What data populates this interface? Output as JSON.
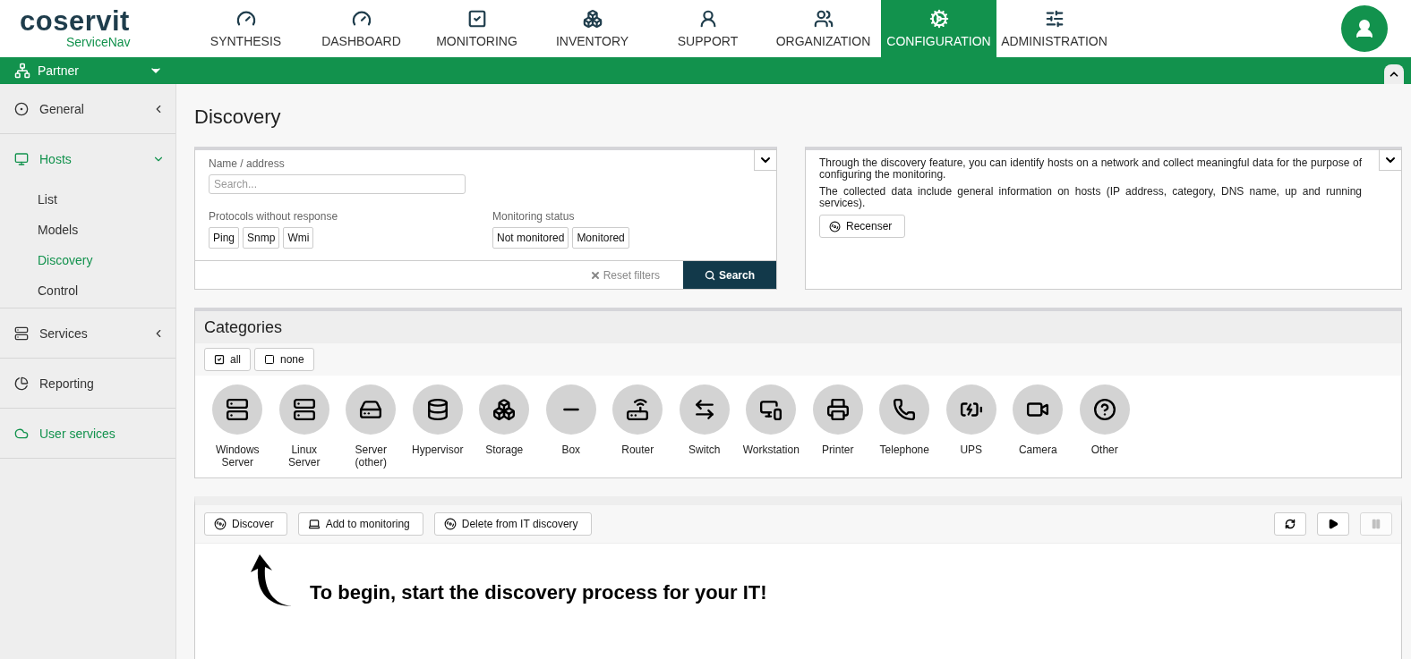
{
  "logo": {
    "name": "coservit",
    "product": "ServiceNav"
  },
  "nav": [
    {
      "label": "SYNTHESIS",
      "selected": false
    },
    {
      "label": "DASHBOARD",
      "selected": false
    },
    {
      "label": "MONITORING",
      "selected": false
    },
    {
      "label": "INVENTORY",
      "selected": false
    },
    {
      "label": "SUPPORT",
      "selected": false
    },
    {
      "label": "ORGANIZATION",
      "selected": false
    },
    {
      "label": "CONFIGURATION",
      "selected": true
    },
    {
      "label": "ADMINISTRATION",
      "selected": false
    }
  ],
  "context_bar": {
    "label": "Partner"
  },
  "sidebar": {
    "items": [
      {
        "label": "General",
        "selected": false,
        "expanded": false
      },
      {
        "label": "Hosts",
        "selected": true,
        "expanded": true,
        "children": [
          {
            "label": "List",
            "selected": false
          },
          {
            "label": "Models",
            "selected": false
          },
          {
            "label": "Discovery",
            "selected": true
          },
          {
            "label": "Control",
            "selected": false
          }
        ]
      },
      {
        "label": "Services",
        "selected": false,
        "expanded": false
      },
      {
        "label": "Reporting",
        "selected": false
      },
      {
        "label": "User services",
        "selected": true
      }
    ]
  },
  "page_title": "Discovery",
  "filters": {
    "name_label": "Name / address",
    "name_placeholder": "Search...",
    "protocols_label": "Protocols without response",
    "protocols": [
      "Ping",
      "Snmp",
      "Wmi"
    ],
    "status_label": "Monitoring status",
    "statuses": [
      "Not monitored",
      "Monitored"
    ],
    "reset": "Reset filters",
    "search": "Search"
  },
  "info": {
    "paragraphs": [
      "Through the discovery feature, you can identify hosts on a network and collect meaningful data for the purpose of configuring the monitoring.",
      "The collected data include general information on hosts (IP address, category, DNS name, up and running services)."
    ],
    "button": "Recenser"
  },
  "categories": {
    "title": "Categories",
    "toggles": [
      {
        "label": "all",
        "checked": true
      },
      {
        "label": "none",
        "checked": false
      }
    ],
    "items": [
      "Windows Server",
      "Linux Server",
      "Server (other)",
      "Hypervisor",
      "Storage",
      "Box",
      "Router",
      "Switch",
      "Workstation",
      "Printer",
      "Telephone",
      "UPS",
      "Camera",
      "Other"
    ]
  },
  "actions": {
    "buttons": [
      "Discover",
      "Add to monitoring",
      "Delete from IT discovery"
    ],
    "controls": [
      {
        "kind": "refresh",
        "disabled": false
      },
      {
        "kind": "play",
        "disabled": false
      },
      {
        "kind": "pause",
        "disabled": true
      }
    ]
  },
  "hint": "To begin, start the discovery process for your IT!"
}
